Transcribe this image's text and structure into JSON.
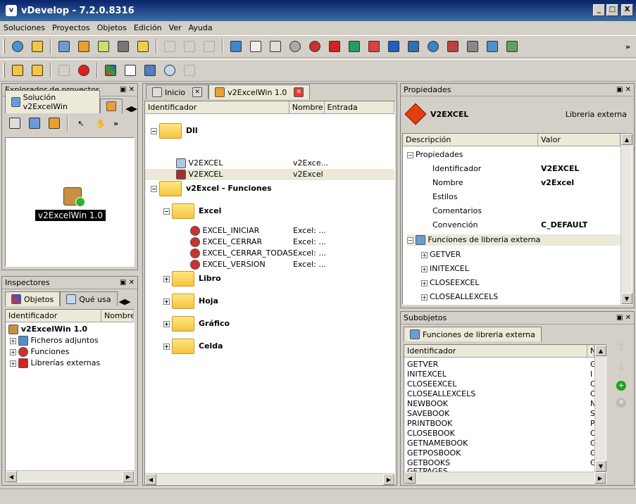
{
  "window": {
    "title": "vDevelop - 7.2.0.8316",
    "min": "_",
    "max": "□",
    "close": "X"
  },
  "menu": [
    "Soluciones",
    "Proyectos",
    "Objetos",
    "Edición",
    "Ver",
    "Ayuda"
  ],
  "toolbar": {
    "more": "»"
  },
  "explorer": {
    "title": "Explorador de proyectos",
    "tab": "Solución v2ExcelWin",
    "more": "»",
    "project_label": "v2ExcelWin 1.0"
  },
  "inspectors": {
    "title": "Inspectores",
    "tabs": [
      "Objetos",
      "Qué usa"
    ],
    "columns": [
      "Identificador",
      "Nombre"
    ],
    "root": "v2ExcelWin 1.0",
    "items": [
      "Ficheros adjuntos",
      "Funciones",
      "Librerías externas"
    ]
  },
  "editor": {
    "tabs": [
      "Inicio",
      "v2ExcelWin 1.0"
    ],
    "columns": [
      "Identificador",
      "Nombre",
      "Entrada"
    ],
    "groups": {
      "dll": "Dll",
      "funciones": "v2Excel - Funciones",
      "excel": "Excel",
      "libro": "Libro",
      "hoja": "Hoja",
      "grafico": "Gráfico",
      "celda": "Celda"
    },
    "dll_rows": [
      {
        "id": "V2EXCEL",
        "name": "v2Exce..."
      },
      {
        "id": "V2EXCEL",
        "name": "v2Excel"
      }
    ],
    "excel_rows": [
      {
        "id": "EXCEL_INICIAR",
        "name": "Excel: ..."
      },
      {
        "id": "EXCEL_CERRAR",
        "name": "Excel: ..."
      },
      {
        "id": "EXCEL_CERRAR_TODAS",
        "name": "Excel: ..."
      },
      {
        "id": "EXCEL_VERSION",
        "name": "Excel: ..."
      }
    ]
  },
  "properties": {
    "title": "Propiedades",
    "object_name": "V2EXCEL",
    "object_type": "Libreria externa",
    "columns": [
      "Descripción",
      "Valor"
    ],
    "group": "Propiedades",
    "rows": [
      {
        "label": "Identificador",
        "value": "V2EXCEL"
      },
      {
        "label": "Nombre",
        "value": "v2Excel"
      },
      {
        "label": "Estilos",
        "value": ""
      },
      {
        "label": "Comentarios",
        "value": ""
      },
      {
        "label": "Convención",
        "value": "C_DEFAULT"
      }
    ],
    "functions_group": "Funciones de libreria externa",
    "functions": [
      "GETVER",
      "INITEXCEL",
      "CLOSEEXCEL",
      "CLOSEALLEXCELS"
    ]
  },
  "subobjects": {
    "title": "Subobjetos",
    "tab": "Funciones de libreria externa",
    "columns": [
      "Identificador",
      "N"
    ],
    "rows": [
      {
        "id": "GETVER",
        "n": "G"
      },
      {
        "id": "INITEXCEL",
        "n": "I"
      },
      {
        "id": "CLOSEEXCEL",
        "n": "C"
      },
      {
        "id": "CLOSEALLEXCELS",
        "n": "C"
      },
      {
        "id": "NEWBOOK",
        "n": "N"
      },
      {
        "id": "SAVEBOOK",
        "n": "S"
      },
      {
        "id": "PRINTBOOK",
        "n": "P"
      },
      {
        "id": "CLOSEBOOK",
        "n": "C"
      },
      {
        "id": "GETNAMEBOOK",
        "n": "G"
      },
      {
        "id": "GETPOSBOOK",
        "n": "G"
      },
      {
        "id": "GETBOOKS",
        "n": "G"
      },
      {
        "id": "GETPAGES",
        "n": "G"
      }
    ]
  },
  "colors": {
    "accent": "#0a246a",
    "selection": "#ece9d8",
    "folder": "#f5c542"
  }
}
